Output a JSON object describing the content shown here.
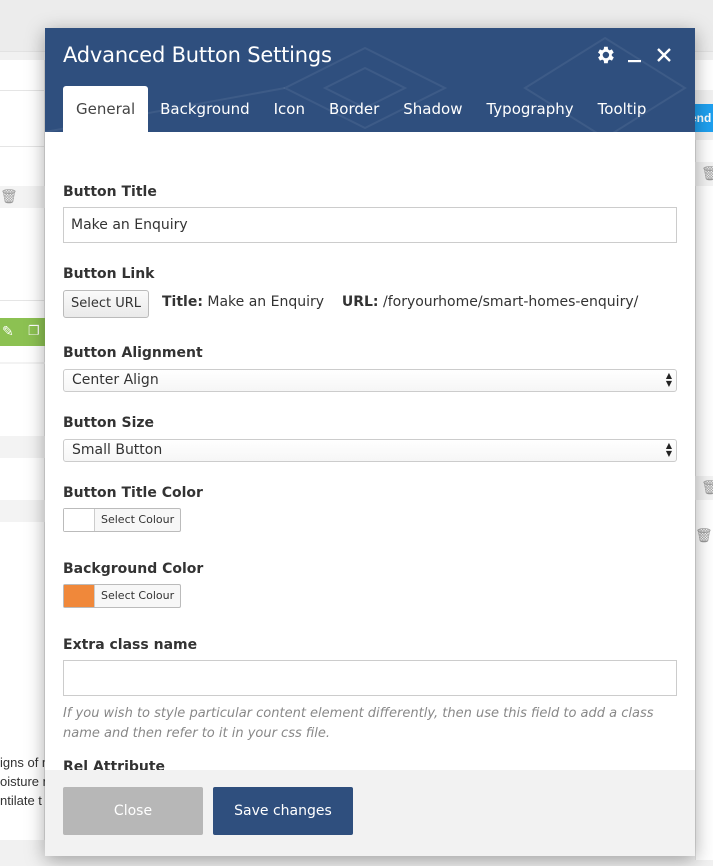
{
  "background": {
    "side_text": [
      "igns of m",
      "oisture n",
      "ntilate t"
    ],
    "right_button_label": "end"
  },
  "modal": {
    "title": "Advanced Button Settings",
    "tabs": [
      {
        "label": "General",
        "active": true
      },
      {
        "label": "Background",
        "active": false
      },
      {
        "label": "Icon",
        "active": false
      },
      {
        "label": "Border",
        "active": false
      },
      {
        "label": "Shadow",
        "active": false
      },
      {
        "label": "Typography",
        "active": false
      },
      {
        "label": "Tooltip",
        "active": false
      }
    ],
    "icons": {
      "settings": "gear-icon",
      "minimize": "minimize-icon",
      "close": "close-icon"
    },
    "fields": {
      "button_title": {
        "label": "Button Title",
        "value": "Make an Enquiry"
      },
      "button_link": {
        "label": "Button Link",
        "select_label": "Select URL",
        "title_key": "Title:",
        "title_value": "Make an Enquiry",
        "url_key": "URL:",
        "url_value": "/foryourhome/smart-homes-enquiry/"
      },
      "button_alignment": {
        "label": "Button Alignment",
        "value": "Center Align"
      },
      "button_size": {
        "label": "Button Size",
        "value": "Small Button"
      },
      "button_title_color": {
        "label": "Button Title Color",
        "picker_label": "Select Colour",
        "color": "#ffffff"
      },
      "background_color": {
        "label": "Background Color",
        "picker_label": "Select Colour",
        "color": "#f0883a"
      },
      "extra_class": {
        "label": "Extra class name",
        "value": "",
        "help": "If you wish to style particular content element differently, then use this field to add a class name and then refer to it in your css file."
      },
      "rel_attribute": {
        "label": "Rel Attribute",
        "value": ""
      }
    },
    "footer": {
      "close_label": "Close",
      "save_label": "Save changes"
    },
    "colors": {
      "header": "#2f4f7e",
      "close_button": "#b7b7b7",
      "save_button": "#2f4f7e",
      "accent_blue": "#1ea0f0",
      "accent_green": "#8cc152"
    }
  }
}
